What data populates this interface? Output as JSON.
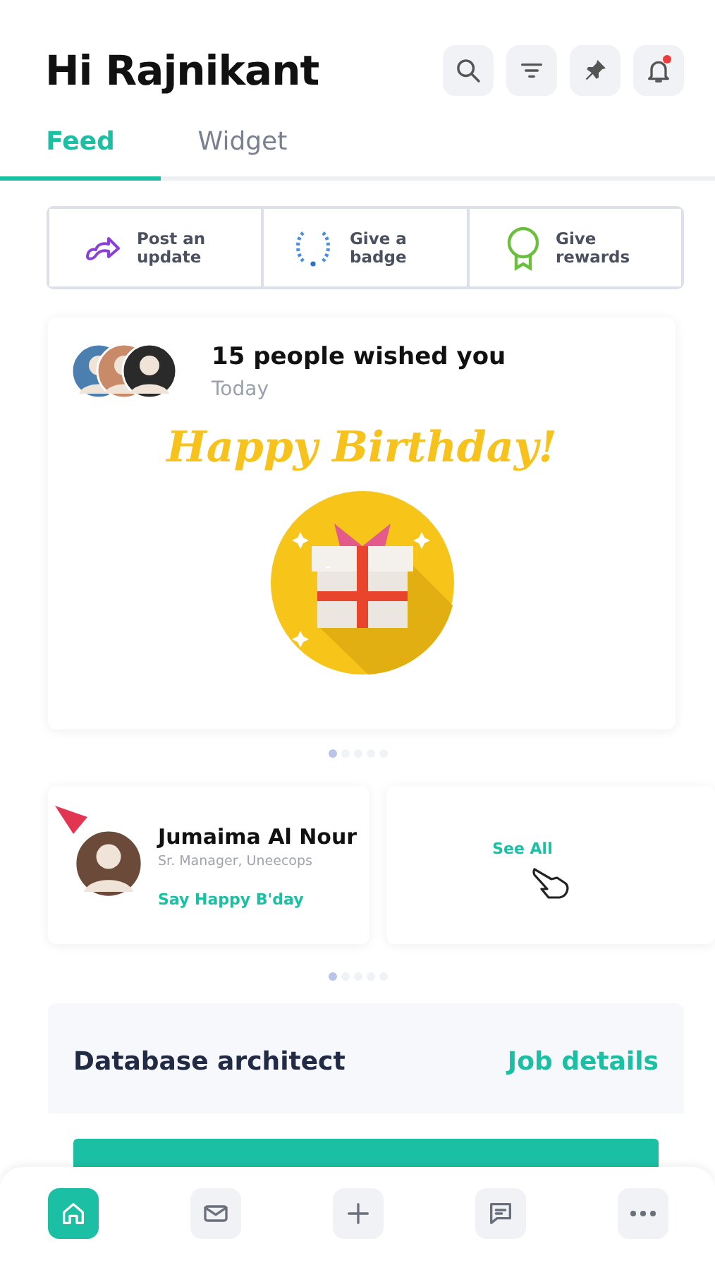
{
  "header": {
    "title": "Hi Rajnikant",
    "actions": [
      {
        "kind": "search"
      },
      {
        "kind": "filter"
      },
      {
        "kind": "pin"
      },
      {
        "kind": "bell",
        "unread": true
      }
    ]
  },
  "tabs": [
    {
      "label": "Feed",
      "selected": true
    },
    {
      "label": "Widget",
      "selected": false
    }
  ],
  "quick_actions": [
    {
      "kind": "post",
      "label": "Post an update"
    },
    {
      "kind": "badge",
      "label": "Give a badge"
    },
    {
      "kind": "reward",
      "label": "Give rewards"
    }
  ],
  "wish_card": {
    "title": "15 people wished you",
    "subtitle": "Today",
    "greeting": "Happy Birthday!",
    "pager": [
      {
        "selected": true
      },
      {
        "selected": false
      },
      {
        "selected": false
      },
      {
        "selected": false
      },
      {
        "selected": false
      }
    ]
  },
  "birthdays": {
    "person": {
      "name": "Jumaima Al Nour",
      "role": "Sr. Manager, Uneecops",
      "action": "Say Happy B'day"
    },
    "see_all": "See All",
    "pager": [
      {
        "selected": true
      },
      {
        "selected": false
      },
      {
        "selected": false
      },
      {
        "selected": false
      },
      {
        "selected": false
      }
    ]
  },
  "job_card": {
    "title": "Database architect",
    "link": "Job details"
  },
  "bottom_nav": [
    {
      "kind": "home",
      "selected": true
    },
    {
      "kind": "mail",
      "selected": false
    },
    {
      "kind": "add",
      "selected": false
    },
    {
      "kind": "chat",
      "selected": false
    },
    {
      "kind": "more",
      "selected": false
    }
  ]
}
